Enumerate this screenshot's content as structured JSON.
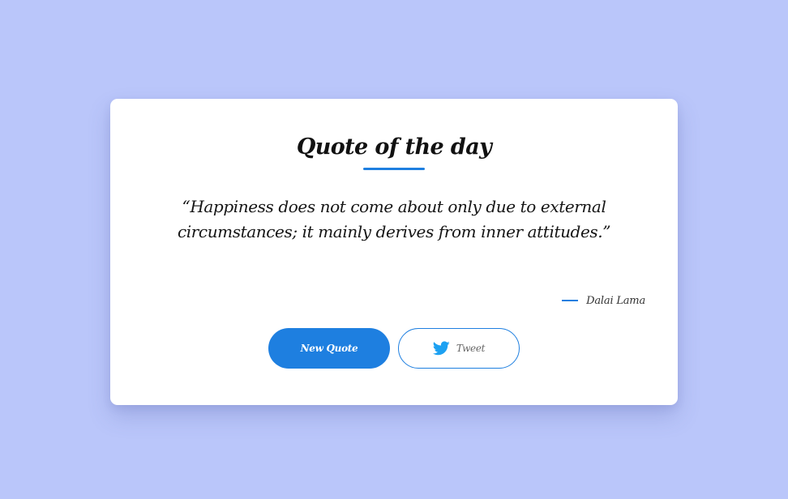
{
  "page": {
    "background_color": "#bac6fa",
    "accent_color": "#1e7fe0"
  },
  "card": {
    "title": "Quote of the day",
    "quote": "“Happiness does not come about only due to external circumstances; it mainly derives from inner attitudes.”",
    "author": "Dalai Lama"
  },
  "buttons": {
    "new_quote_label": "New Quote",
    "tweet_label": "Tweet",
    "tweet_icon": "twitter-bird-icon",
    "tweet_icon_color": "#1da1f2"
  }
}
